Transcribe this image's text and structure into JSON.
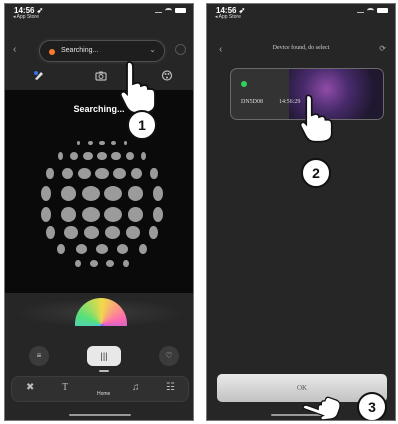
{
  "screens": [
    {
      "status": {
        "time": "14:56 ➶",
        "back_app": "◂ App Store"
      },
      "device_selector": {
        "value": "Searching..."
      },
      "stage": {
        "status_text": "Searching..."
      },
      "nav": {
        "home_label": "Home"
      },
      "step": "1"
    },
    {
      "status": {
        "time": "14:56 ➶",
        "back_app": "◂ App Store"
      },
      "title": "Device found, do select",
      "device": {
        "id": "DN5D08",
        "time": "14:56:29"
      },
      "ok_label": "OK",
      "steps": [
        "2",
        "3"
      ]
    }
  ],
  "colors": {
    "accent_searching": "#ff7a2f",
    "found_indicator": "#2fd35a",
    "icon_active": "#3a6ee8"
  },
  "icons": [
    "back-icon",
    "power-icon",
    "palette-icon",
    "camera-icon",
    "brush-icon",
    "menu-icon",
    "equalizer-icon",
    "heart-icon",
    "font-icon",
    "music-icon",
    "settings-icon",
    "refresh-icon"
  ]
}
